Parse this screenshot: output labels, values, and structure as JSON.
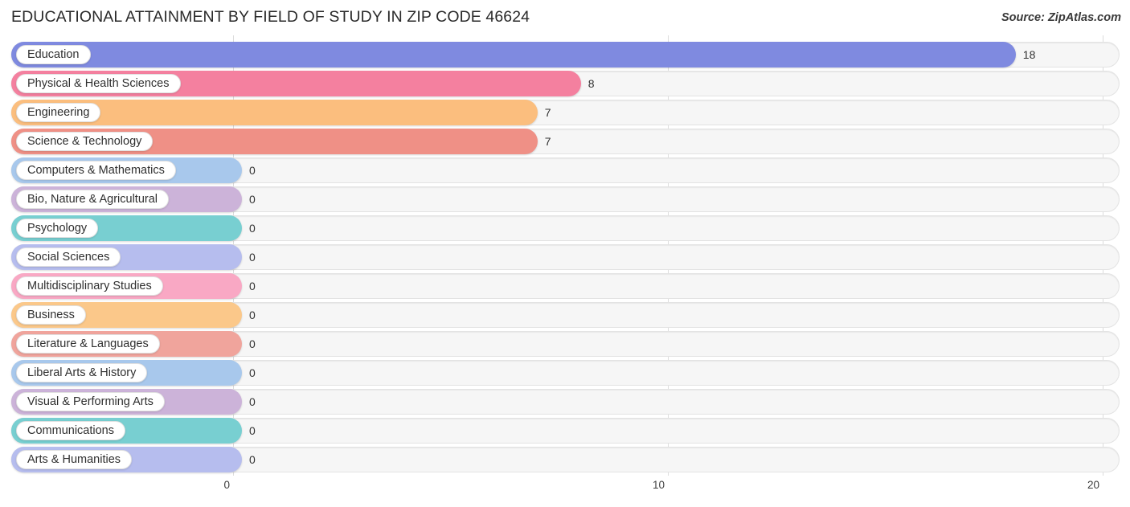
{
  "header": {
    "title": "EDUCATIONAL ATTAINMENT BY FIELD OF STUDY IN ZIP CODE 46624",
    "source": "Source: ZipAtlas.com"
  },
  "chart_data": {
    "type": "bar",
    "orientation": "horizontal",
    "title": "EDUCATIONAL ATTAINMENT BY FIELD OF STUDY IN ZIP CODE 46624",
    "xlabel": "",
    "ylabel": "",
    "xlim": [
      0,
      20
    ],
    "xticks": [
      0,
      10,
      20
    ],
    "xtick_labels": [
      "0",
      "10",
      "20"
    ],
    "grid": true,
    "legend": "none",
    "categories": [
      "Education",
      "Physical & Health Sciences",
      "Engineering",
      "Science & Technology",
      "Computers & Mathematics",
      "Bio, Nature & Agricultural",
      "Psychology",
      "Social Sciences",
      "Multidisciplinary Studies",
      "Business",
      "Literature & Languages",
      "Liberal Arts & History",
      "Visual & Performing Arts",
      "Communications",
      "Arts & Humanities"
    ],
    "values": [
      18,
      8,
      7,
      7,
      0,
      0,
      0,
      0,
      0,
      0,
      0,
      0,
      0,
      0,
      0
    ],
    "value_labels": [
      "18",
      "8",
      "7",
      "7",
      "0",
      "0",
      "0",
      "0",
      "0",
      "0",
      "0",
      "0",
      "0",
      "0",
      "0"
    ],
    "colors": [
      "#7f8ae0",
      "#f4809f",
      "#fbbe7e",
      "#ef9086",
      "#a8c8ec",
      "#ccb3d9",
      "#78cfd1",
      "#b6bdee",
      "#f9a8c4",
      "#fbc88a",
      "#f0a49c",
      "#a8c8ec",
      "#ccb3d9",
      "#78cfd1",
      "#b6bdee"
    ]
  }
}
